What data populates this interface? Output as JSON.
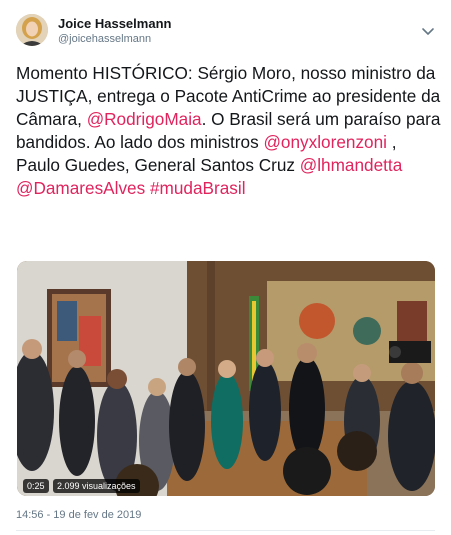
{
  "author": {
    "name": "Joice Hasselmann",
    "handle": "@joicehasselmann"
  },
  "tweet": {
    "segments": [
      {
        "text": "Momento HISTÓRICO: Sérgio Moro, nosso ministro da JUSTIÇA, entrega o Pacote AntiCrime ao presidente da Câmara, ",
        "link": false
      },
      {
        "text": "@RodrigoMaia",
        "link": true
      },
      {
        "text": ".  O Brasil será um paraíso para bandidos. Ao lado dos ministros ",
        "link": false
      },
      {
        "text": "@onyxlorenzoni",
        "link": true
      },
      {
        "text": " , Paulo Guedes, General Santos Cruz ",
        "link": false
      },
      {
        "text": "@lhmandetta",
        "link": true
      },
      {
        "text": " ",
        "link": false
      },
      {
        "text": "@DamaresAlves",
        "link": true
      },
      {
        "text": " ",
        "link": false
      },
      {
        "text": "#mudaBrasil",
        "link": true
      }
    ]
  },
  "video": {
    "duration": "0:25",
    "views": "2.099 visualizações"
  },
  "timestamp": "14:56 - 19 de fev de 2019",
  "colors": {
    "link": "#e0245e",
    "text": "#14171a",
    "secondary": "#657786"
  },
  "icons": {
    "menu": "chevron-down-icon"
  }
}
